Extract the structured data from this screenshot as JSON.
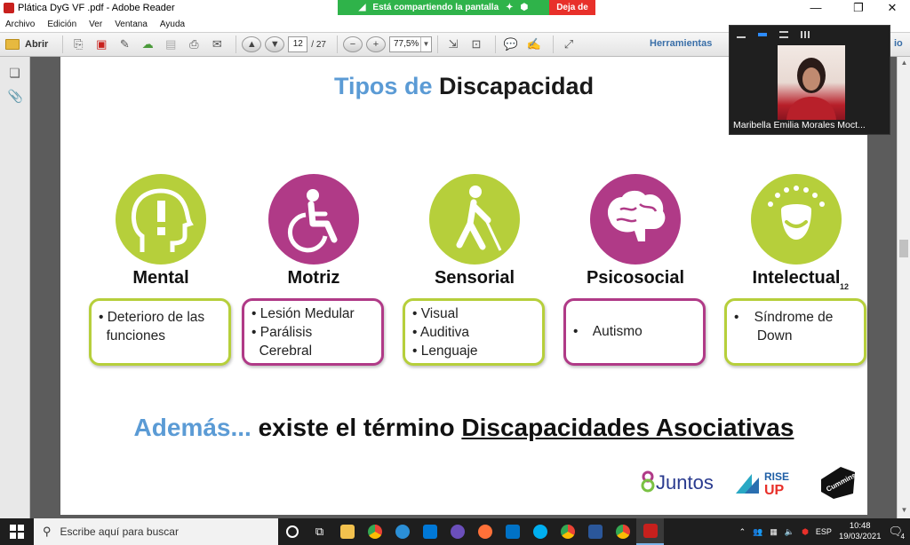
{
  "window": {
    "title": "Plática DyG VF .pdf - Adobe Reader",
    "share_status": "Está compartiendo la pantalla",
    "stop_share_label": "Deja de"
  },
  "menu": [
    "Archivo",
    "Edición",
    "Ver",
    "Ventana",
    "Ayuda"
  ],
  "toolbar": {
    "open_label": "Abrir",
    "page_current": "12",
    "page_total": "/ 27",
    "zoom_value": "77,5%",
    "tools_label": "Herramientas",
    "overflow_label": "io"
  },
  "slide": {
    "title_part1": "Tipos de",
    "title_part2": "Discapacidad",
    "page_number": "12",
    "categories": [
      {
        "name": "Mental",
        "items": [
          "• Deterioro de las",
          "  funciones"
        ]
      },
      {
        "name": "Motriz",
        "items": [
          "• Lesión Medular",
          "• Parálisis",
          "  Cerebral"
        ]
      },
      {
        "name": "Sensorial",
        "items": [
          "• Visual",
          "• Auditiva",
          "• Lenguaje"
        ]
      },
      {
        "name": "Psicosocial",
        "items": [
          "•    Autismo"
        ]
      },
      {
        "name": "Intelectual",
        "items": [
          "•    Síndrome de",
          "      Down"
        ]
      }
    ],
    "footer_accent": "Además...",
    "footer_text": " existe el término ",
    "footer_underlined": "Discapacidades Asociativas",
    "logos": {
      "juntos": "Juntos",
      "rise": "RISE UP",
      "cummins": "Cummins"
    }
  },
  "video": {
    "participant_name": "Maribella Emilia Morales Moct..."
  },
  "taskbar": {
    "search_placeholder": "Escribe aquí para buscar",
    "language": "ESP",
    "time": "10:48",
    "date": "19/03/2021",
    "notification_count": "4"
  },
  "colors": {
    "accent_blue": "#5b9bd5",
    "lime_green": "#b6cf3b",
    "magenta": "#b03a87",
    "share_green": "#2fb34a",
    "share_red": "#e8302a"
  }
}
